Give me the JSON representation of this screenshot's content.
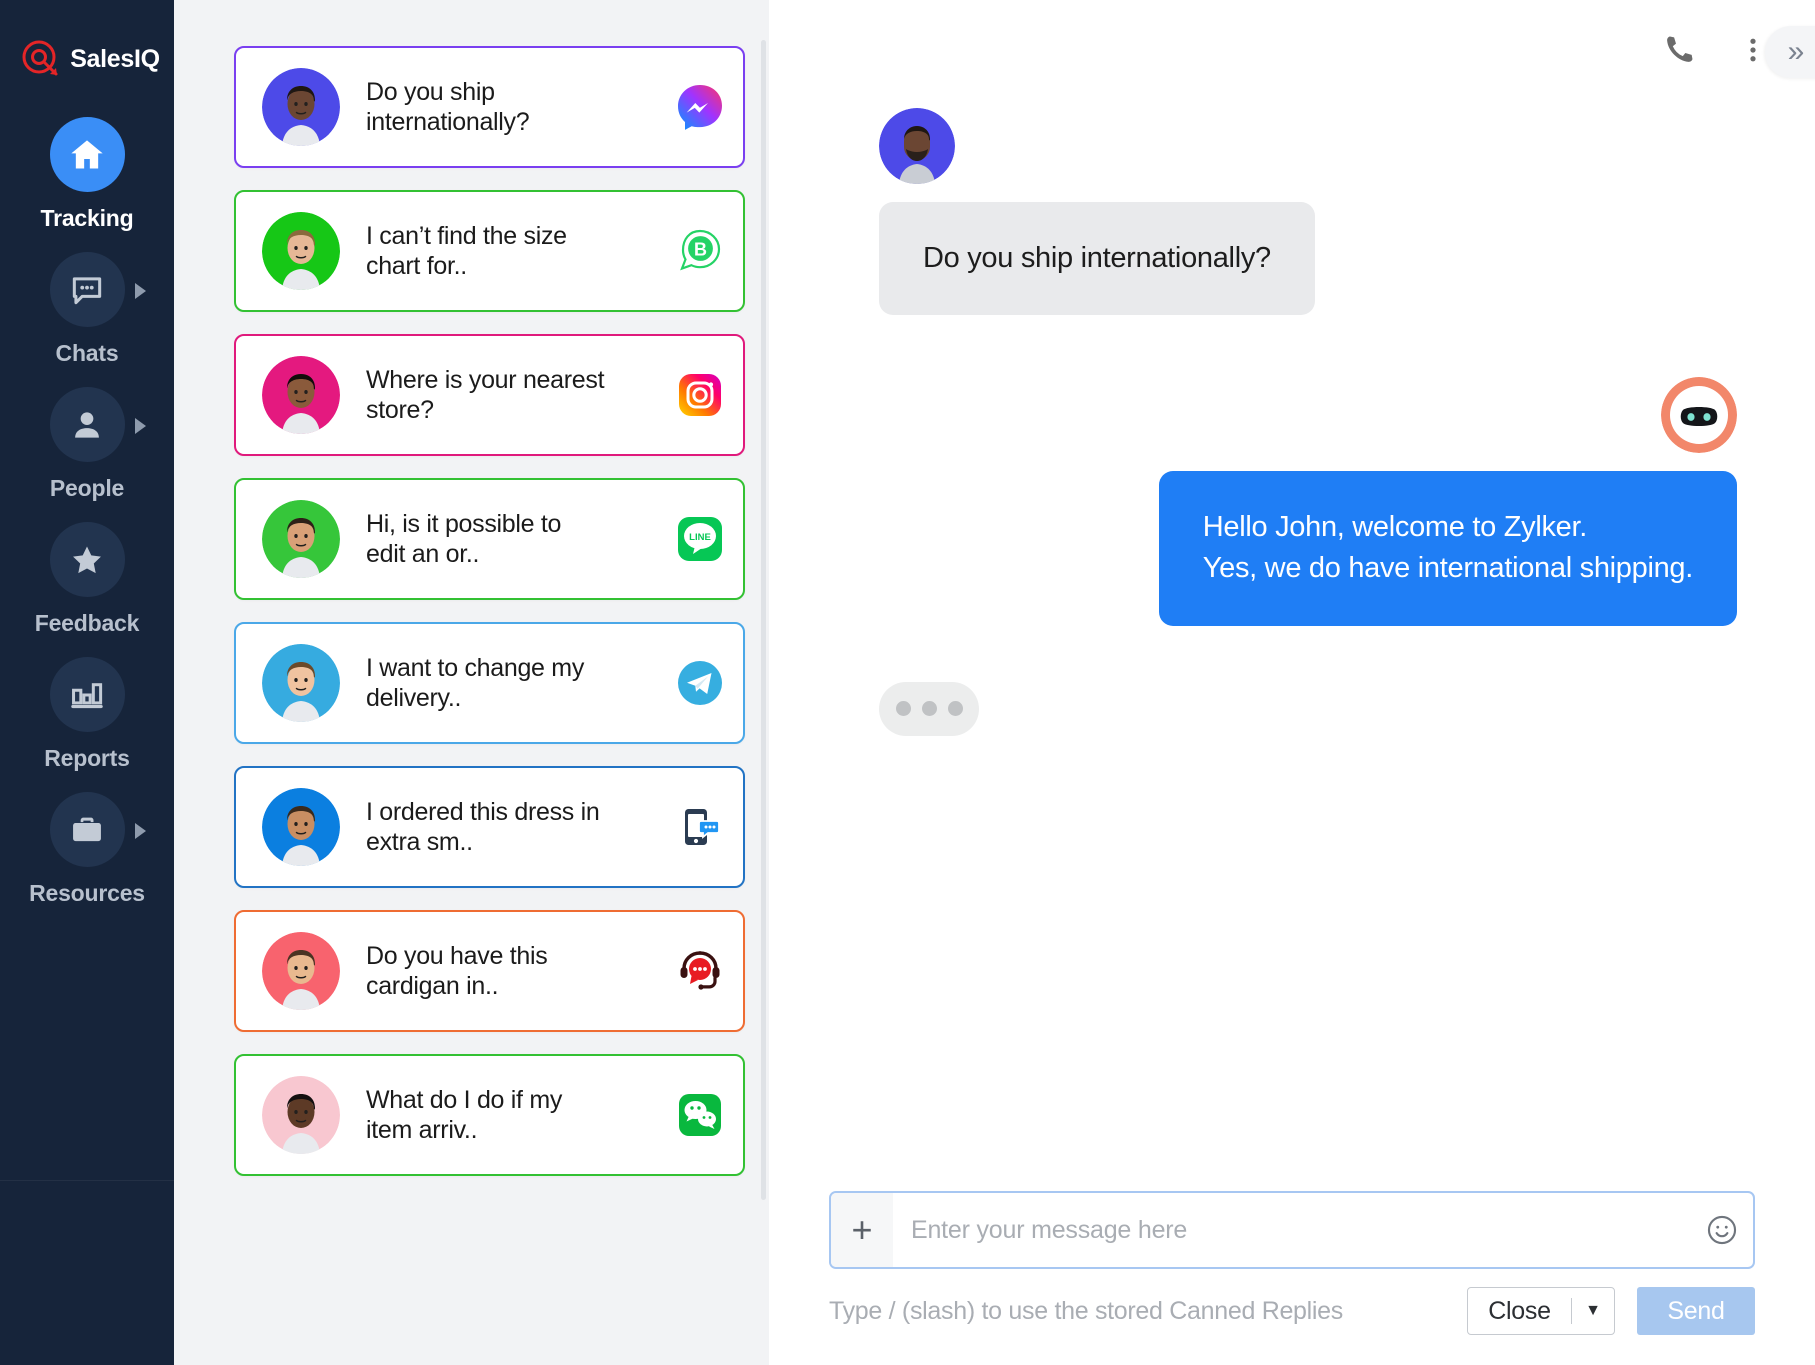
{
  "sidebar": {
    "brand": {
      "name": "SalesIQ",
      "logo_icon": "salesiq-logo-icon"
    },
    "items": [
      {
        "label": "Tracking",
        "icon": "home-icon",
        "active": true,
        "has_arrow": false
      },
      {
        "label": "Chats",
        "icon": "chat-bubble-icon",
        "active": false,
        "has_arrow": true
      },
      {
        "label": "People",
        "icon": "person-icon",
        "active": false,
        "has_arrow": true
      },
      {
        "label": "Feedback",
        "icon": "star-icon",
        "active": false,
        "has_arrow": false
      },
      {
        "label": "Reports",
        "icon": "bar-chart-icon",
        "active": false,
        "has_arrow": false
      },
      {
        "label": "Resources",
        "icon": "briefcase-icon",
        "active": false,
        "has_arrow": true
      }
    ]
  },
  "chat_list": {
    "items": [
      {
        "preview": "Do you ship\ninternationally?",
        "channel": "messenger-icon",
        "channel_label": "Facebook Messenger",
        "border_color": "#7a3ff0",
        "avatar_bg": "#4d4ae8",
        "selected": true
      },
      {
        "preview": "I can’t find the size\nchart for..",
        "channel": "whatsapp-business-icon",
        "channel_label": "WhatsApp Business",
        "border_color": "#33c133",
        "avatar_bg": "#16c716",
        "selected": false
      },
      {
        "preview": "Where is your nearest\nstore?",
        "channel": "instagram-icon",
        "channel_label": "Instagram",
        "border_color": "#e0197c",
        "avatar_bg": "#e4197f",
        "selected": false
      },
      {
        "preview": "Hi, is it possible to\nedit an or..",
        "channel": "line-icon",
        "channel_label": "LINE",
        "border_color": "#33c133",
        "avatar_bg": "#36c63a",
        "selected": false
      },
      {
        "preview": " I want to change my\ndelivery..",
        "channel": "telegram-icon",
        "channel_label": "Telegram",
        "border_color": "#4ba8e8",
        "avatar_bg": "#36abe0",
        "selected": false
      },
      {
        "preview": "I ordered this dress in\nextra sm..",
        "channel": "mobile-sdk-icon",
        "channel_label": "Mobile SDK",
        "border_color": "#2273c4",
        "avatar_bg": "#0b7fe0",
        "selected": false
      },
      {
        "preview": "Do you have this\ncardigan in..",
        "channel": "support-headset-icon",
        "channel_label": "Live Chat",
        "border_color": "#ef6c33",
        "avatar_bg": "#f8636e",
        "selected": false
      },
      {
        "preview": "What do I do if my\nitem arriv..",
        "channel": "wechat-icon",
        "channel_label": "WeChat",
        "border_color": "#33c133",
        "avatar_bg": "#f8c7d0",
        "selected": false
      }
    ]
  },
  "conversation": {
    "header": {
      "call_icon": "phone-icon",
      "menu_icon": "more-vertical-icon",
      "expand_icon": "chevron-double-right-icon",
      "expand_label": "»"
    },
    "messages": [
      {
        "from": "visitor",
        "avatar": "visitor-avatar",
        "text": "Do you ship internationally?"
      },
      {
        "from": "bot",
        "avatar": "bot-avatar",
        "text": "Hello John, welcome to Zylker.\nYes, we do have international shipping."
      }
    ],
    "typing_indicator": {
      "visible": true,
      "dots": 3
    }
  },
  "composer": {
    "add_label": "+",
    "placeholder": "Enter your message here",
    "value": "",
    "emoji_icon": "smiley-icon",
    "hint": "Type / (slash) to use the stored Canned Replies",
    "status_select": {
      "value": "Close",
      "caret": "▼"
    },
    "send_label": "Send"
  },
  "colors": {
    "sidebar_bg": "#16243a",
    "accent_blue": "#3a8ef6",
    "outgoing_bubble": "#1f7ef5",
    "incoming_bubble": "#e9eaec",
    "list_bg": "#f2f3f5"
  }
}
